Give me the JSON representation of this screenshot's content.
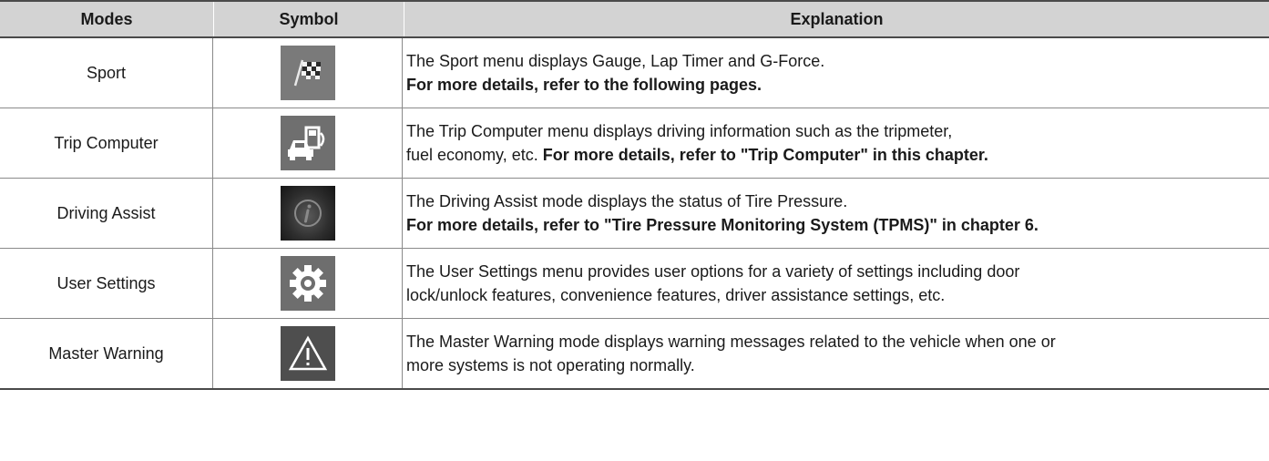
{
  "table": {
    "headers": {
      "modes": "Modes",
      "symbol": "Symbol",
      "explanation": "Explanation"
    },
    "rows": [
      {
        "mode": "Sport",
        "icon": "checkered-flag-icon",
        "text1": "The Sport menu displays Gauge, Lap Timer and G-Force.",
        "bold1": "For more details, refer to the following pages."
      },
      {
        "mode": "Trip Computer",
        "icon": "fuel-pump-car-icon",
        "text1": "The Trip Computer menu displays driving information such as the tripmeter,",
        "text2": "fuel economy, etc.",
        "bold2": "For more details, refer to \"Trip Computer\" in this chapter."
      },
      {
        "mode": "Driving Assist",
        "icon": "info-icon",
        "text1": "The Driving Assist mode displays the status of Tire Pressure.",
        "bold1": "For more details, refer to \"Tire Pressure Monitoring System (TPMS)\" in chapter 6."
      },
      {
        "mode": "User Settings",
        "icon": "gear-icon",
        "text1": "The User Settings menu provides user options for a variety of settings including door",
        "text2": "lock/unlock features, convenience features, driver assistance settings, etc."
      },
      {
        "mode": "Master Warning",
        "icon": "warning-triangle-icon",
        "text1": "The Master Warning mode displays warning messages related to the vehicle when one or",
        "text2": "more systems is not operating normally."
      }
    ]
  }
}
